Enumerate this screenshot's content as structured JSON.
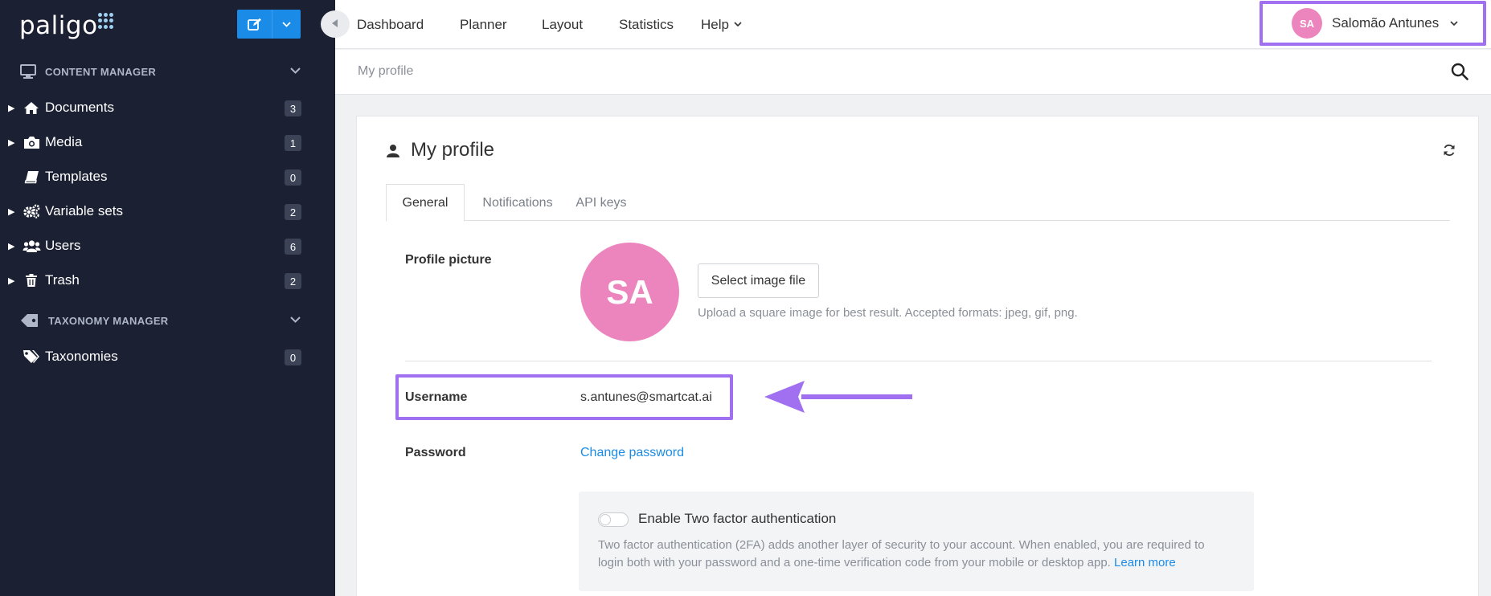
{
  "brand": {
    "logo_text": "paligo"
  },
  "sidebar": {
    "content_manager_label": "CONTENT MANAGER",
    "taxonomy_manager_label": "TAXONOMY MANAGER",
    "items": [
      {
        "label": "Documents",
        "count": "3"
      },
      {
        "label": "Media",
        "count": "1"
      },
      {
        "label": "Templates",
        "count": "0"
      },
      {
        "label": "Variable sets",
        "count": "2"
      },
      {
        "label": "Users",
        "count": "6"
      },
      {
        "label": "Trash",
        "count": "2"
      }
    ],
    "taxonomy_items": [
      {
        "label": "Taxonomies",
        "count": "0"
      }
    ]
  },
  "topnav": {
    "dashboard": "Dashboard",
    "planner": "Planner",
    "layout": "Layout",
    "statistics": "Statistics",
    "help": "Help"
  },
  "user": {
    "initials": "SA",
    "name": "Salomão Antunes"
  },
  "breadcrumb": "My profile",
  "profile": {
    "title": "My profile",
    "tabs": [
      "General",
      "Notifications",
      "API keys"
    ],
    "picture_label": "Profile picture",
    "avatar_initials": "SA",
    "select_image_label": "Select image file",
    "upload_hint": "Upload a square image for best result. Accepted formats: jpeg, gif, png.",
    "username_label": "Username",
    "username_value": "s.antunes@smartcat.ai",
    "password_label": "Password",
    "change_password_label": "Change password",
    "twofa_title": "Enable Two factor authentication",
    "twofa_desc": "Two factor authentication (2FA) adds another layer of security to your account. When enabled, you are required to login both with your password and a one-time verification code from your mobile or desktop app.",
    "learn_more": "Learn more"
  },
  "colors": {
    "sidebar_bg": "#1b2033",
    "accent": "#1a8be6",
    "highlight": "#a070f0",
    "avatar": "#ec85bd"
  }
}
